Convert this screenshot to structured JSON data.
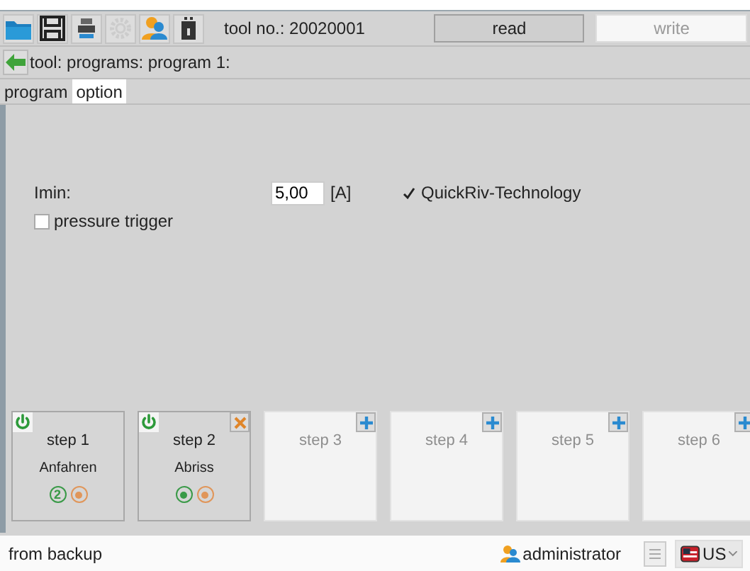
{
  "toolbar": {
    "icons": [
      {
        "kind": "folder",
        "disabled": false
      },
      {
        "kind": "save",
        "disabled": false
      },
      {
        "kind": "printer",
        "disabled": false
      },
      {
        "kind": "gear",
        "disabled": true
      },
      {
        "kind": "users",
        "disabled": false
      },
      {
        "kind": "device",
        "disabled": false
      }
    ],
    "tool_no": "tool no.: 20020001",
    "buttons": [
      {
        "label": "read",
        "disabled": false
      },
      {
        "label": "write",
        "disabled": true
      }
    ]
  },
  "breadcrumb": "tool: programs: program 1:",
  "tabs": [
    {
      "label": "program",
      "selected": false
    },
    {
      "label": "option",
      "selected": true
    }
  ],
  "form": {
    "imin": {
      "label": "Imin:",
      "value": "5,00",
      "unit": "[A]"
    },
    "quickriv": {
      "label": "QuickRiv-Technology",
      "checked": true
    },
    "pressure_trigger": {
      "label": "pressure trigger",
      "checked": false
    }
  },
  "steps": [
    {
      "kind": "active",
      "label": "step 1",
      "name": "Anfahren",
      "removable": false,
      "indicators": [
        {
          "color": "#3a9a48",
          "text": "2"
        },
        {
          "color": "#e0965a"
        }
      ]
    },
    {
      "kind": "active",
      "label": "step 2",
      "name": "Abriss",
      "removable": true,
      "indicators": [
        {
          "color": "#3a9a48"
        },
        {
          "color": "#e0965a"
        }
      ]
    },
    {
      "kind": "empty",
      "label": "step 3"
    },
    {
      "kind": "empty",
      "label": "step 4"
    },
    {
      "kind": "empty",
      "label": "step 5"
    },
    {
      "kind": "empty",
      "label": "step 6"
    }
  ],
  "status_bar": {
    "text": "from backup",
    "user": "administrator",
    "language": "US"
  }
}
